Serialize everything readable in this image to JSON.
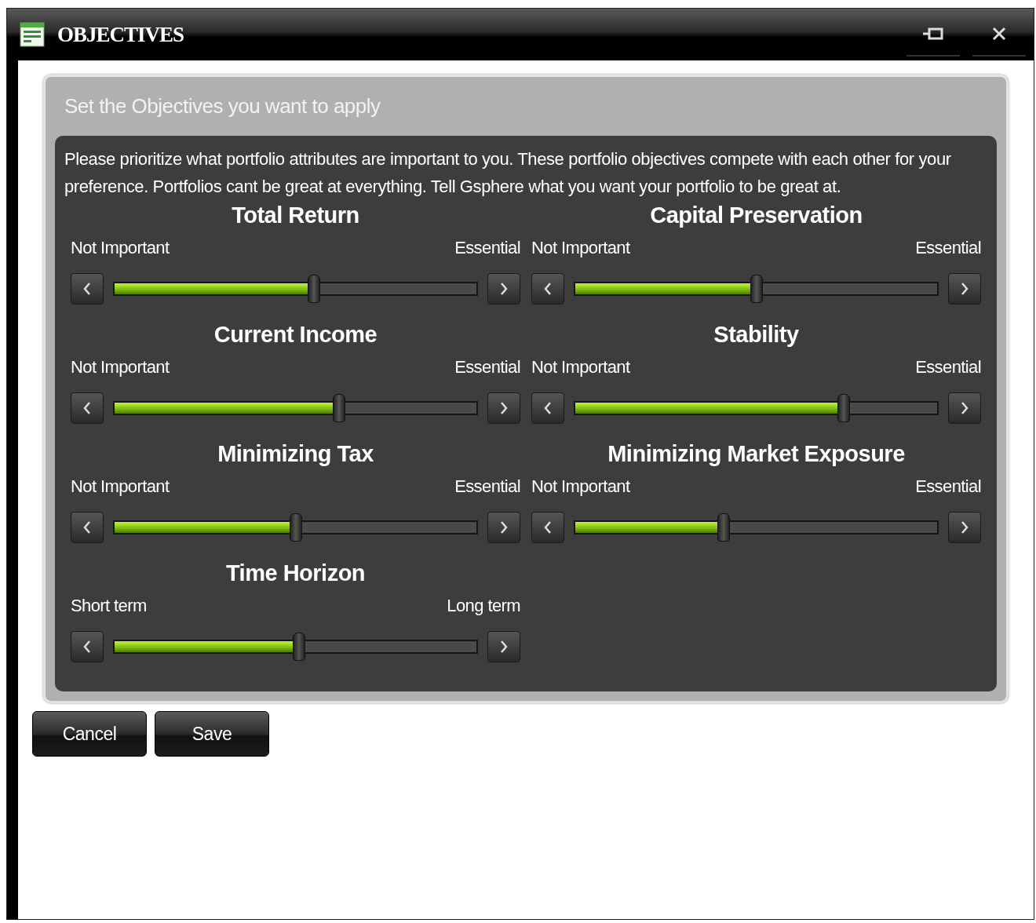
{
  "window": {
    "title": "OBJECTIVES"
  },
  "panel": {
    "heading": "Set the Objectives you want to apply",
    "description": "Please prioritize what portfolio attributes are important to you. These portfolio objectives compete with each other for your preference. Portfolios cant be great at everything. Tell Gsphere what you want your portfolio to be great at."
  },
  "objectives": [
    {
      "title": "Total Return",
      "min_label": "Not Important",
      "max_label": "Essential",
      "level": 0.55
    },
    {
      "title": "Capital Preservation",
      "min_label": "Not Important",
      "max_label": "Essential",
      "level": 0.5
    },
    {
      "title": "Current Income",
      "min_label": "Not Important",
      "max_label": "Essential",
      "level": 0.62
    },
    {
      "title": "Stability",
      "min_label": "Not Important",
      "max_label": "Essential",
      "level": 0.74
    },
    {
      "title": "Minimizing Tax",
      "min_label": "Not Important",
      "max_label": "Essential",
      "level": 0.5
    },
    {
      "title": "Minimizing Market Exposure",
      "min_label": "Not Important",
      "max_label": "Essential",
      "level": 0.41
    },
    {
      "title": "Time Horizon",
      "min_label": "Short term",
      "max_label": "Long term",
      "level": 0.51
    }
  ],
  "buttons": [
    "Cancel",
    "Save"
  ]
}
